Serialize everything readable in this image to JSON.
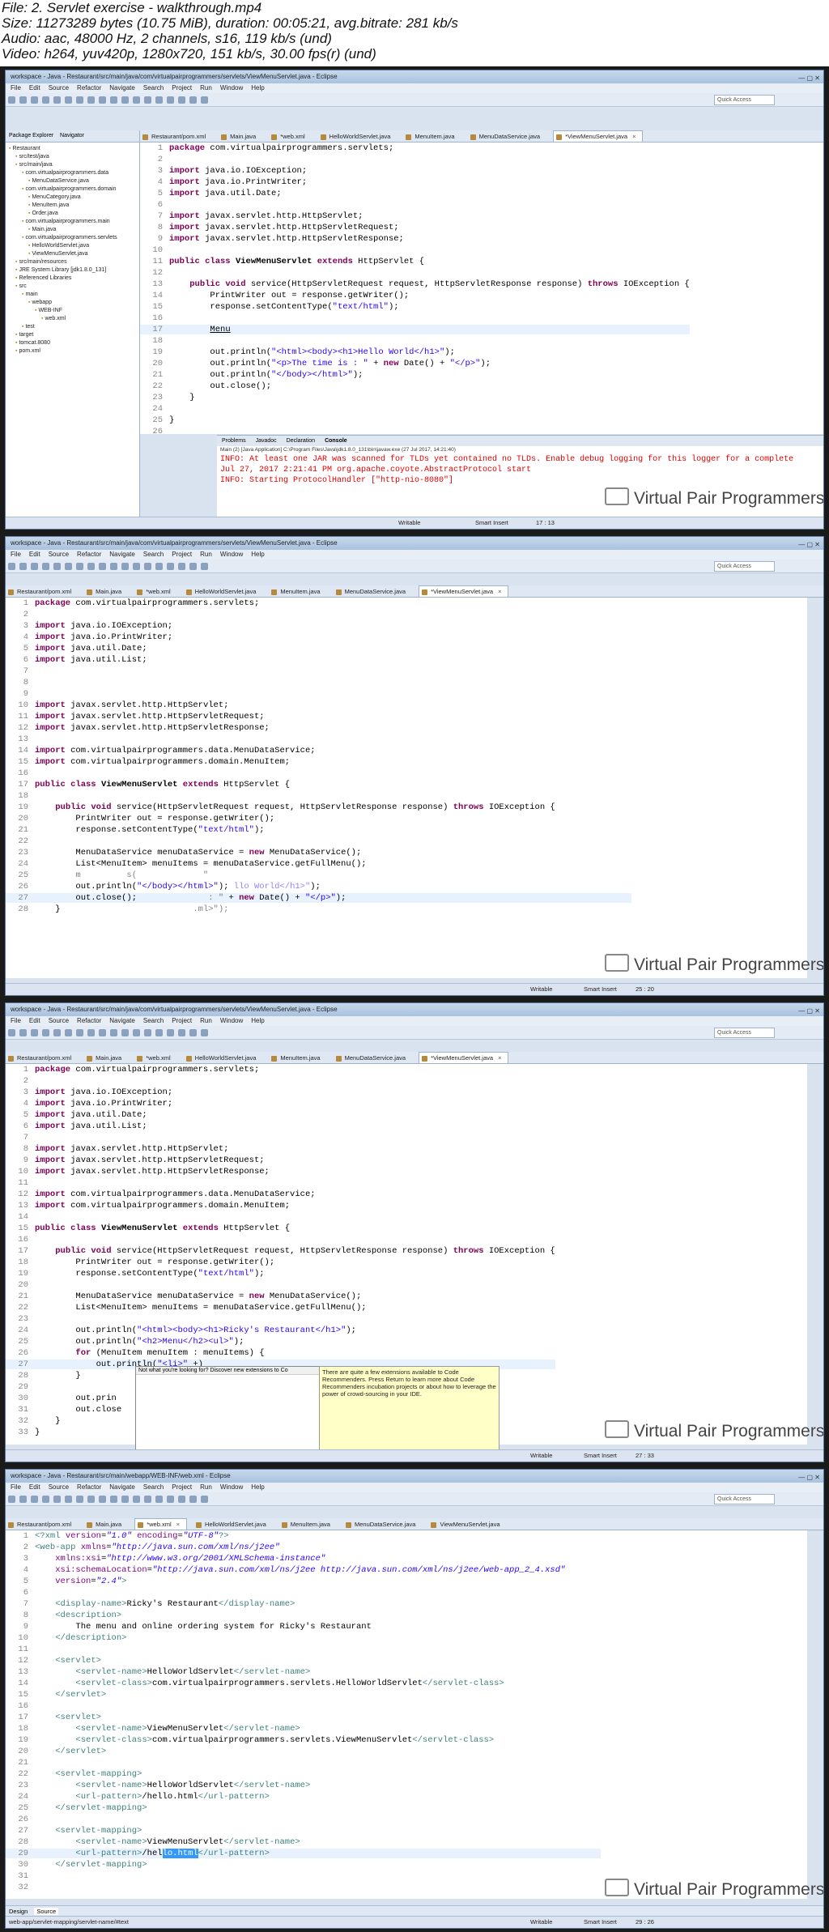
{
  "info": {
    "file": "File: 2. Servlet exercise - walkthrough.mp4",
    "size": "Size: 11273289 bytes (10.75 MiB), duration: 00:05:21, avg.bitrate: 281 kb/s",
    "audio": "Audio: aac, 48000 Hz, 2 channels, s16, 119 kb/s (und)",
    "video": "Video: h264, yuv420p, 1280x720, 151 kb/s, 30.00 fps(r) (und)"
  },
  "menu": [
    "File",
    "Edit",
    "Source",
    "Refactor",
    "Navigate",
    "Search",
    "Project",
    "Run",
    "Window",
    "Help"
  ],
  "quick_access": "Quick Access",
  "watermark": "Virtual Pair Programmers",
  "frame1": {
    "title": "workspace - Java - Restaurant/src/main/java/com/virtualpairprogrammers/servlets/ViewMenuServlet.java - Eclipse",
    "explorer_tabs": [
      "Package Explorer",
      "Navigator"
    ],
    "tree": [
      "Restaurant",
      "src/test/java",
      "src/main/java",
      "com.virtualpairprogrammers.data",
      "MenuDataService.java",
      "com.virtualpairprogrammers.domain",
      "MenuCategory.java",
      "MenuItem.java",
      "Order.java",
      "com.virtualpairprogrammers.main",
      "Main.java",
      "com.virtualpairprogrammers.servlets",
      "HelloWorldServlet.java",
      "ViewMenuServlet.java",
      "src/main/resources",
      "JRE System Library [jdk1.8.0_131]",
      "Referenced Libraries",
      "src",
      "main",
      "webapp",
      "WEB-INF",
      "web.xml",
      "test",
      "target",
      "tomcat.8080",
      "pom.xml"
    ],
    "tabs": [
      "Restaurant/pom.xml",
      "Main.java",
      "*web.xml",
      "HelloWorldServlet.java",
      "MenuItem.java",
      "MenuDataService.java",
      "*ViewMenuServlet.java"
    ],
    "console_tabs": [
      "Problems",
      "Javadoc",
      "Declaration",
      "Console"
    ],
    "console_sub": "Main (2) [Java Application] C:\\Program Files\\Java\\jdk1.8.0_131\\bin\\javaw.exe (27 Jul 2017, 14:21:40)",
    "console_lines": [
      "INFO: At least one JAR was scanned for TLDs yet contained no TLDs. Enable debug logging for this logger for a complete",
      "Jul 27, 2017 2:21:41 PM org.apache.coyote.AbstractProtocol start",
      "INFO: Starting ProtocolHandler [\"http-nio-8080\"]"
    ],
    "status": {
      "writable": "Writable",
      "insert": "Smart Insert",
      "pos": "17 : 13"
    }
  },
  "frame2": {
    "title": "workspace - Java - Restaurant/src/main/java/com/virtualpairprogrammers/servlets/ViewMenuServlet.java - Eclipse",
    "tabs": [
      "Restaurant/pom.xml",
      "Main.java",
      "*web.xml",
      "HelloWorldServlet.java",
      "MenuItem.java",
      "MenuDataService.java",
      "*ViewMenuServlet.java"
    ],
    "status": {
      "writable": "Writable",
      "insert": "Smart Insert",
      "pos": "25 : 20"
    }
  },
  "frame3": {
    "title": "workspace - Java - Restaurant/src/main/java/com/virtualpairprogrammers/servlets/ViewMenuServlet.java - Eclipse",
    "tabs": [
      "Restaurant/pom.xml",
      "Main.java",
      "*web.xml",
      "HelloWorldServlet.java",
      "MenuItem.java",
      "MenuDataService.java",
      "*ViewMenuServlet.java"
    ],
    "popup_text": "Not what you're looking for? Discover new extensions to Co",
    "tooltip": "There are quite a few extensions available to Code Recommenders. Press Return to learn more about Code Recommenders incubation projects or about how to leverage the power of crowd-sourcing in your IDE.",
    "status": {
      "writable": "Writable",
      "insert": "Smart Insert",
      "pos": "27 : 33"
    }
  },
  "frame4": {
    "title": "workspace - Java - Restaurant/src/main/webapp/WEB-INF/web.xml - Eclipse",
    "tabs": [
      "Restaurant/pom.xml",
      "Main.java",
      "*web.xml",
      "HelloWorldServlet.java",
      "MenuItem.java",
      "MenuDataService.java",
      "ViewMenuServlet.java"
    ],
    "bottom_tabs": [
      "Design",
      "Source"
    ],
    "breadcrumb": "web-app/servlet-mapping/servlet-name/#text",
    "status": {
      "writable": "Writable",
      "insert": "Smart Insert",
      "pos": "29 : 26"
    }
  }
}
